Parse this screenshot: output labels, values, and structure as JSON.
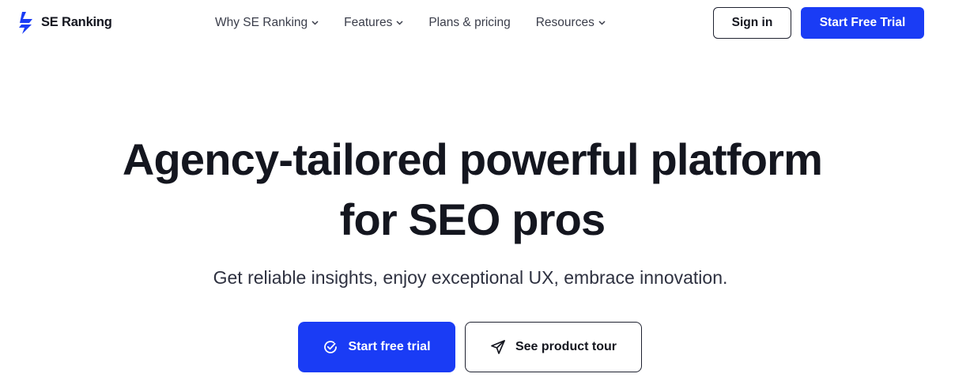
{
  "header": {
    "logo_text": "SE Ranking",
    "nav": [
      {
        "label": "Why SE Ranking",
        "has_dropdown": true
      },
      {
        "label": "Features",
        "has_dropdown": true
      },
      {
        "label": "Plans & pricing",
        "has_dropdown": false
      },
      {
        "label": "Resources",
        "has_dropdown": true
      }
    ],
    "sign_in_label": "Sign in",
    "start_trial_label": "Start Free Trial"
  },
  "hero": {
    "title_line1": "Agency-tailored powerful platform",
    "title_line2": "for SEO pros",
    "subtitle": "Get reliable insights, enjoy exceptional UX, embrace innovation.",
    "cta_primary_label": "Start free trial",
    "cta_primary_icon": "check-circle-icon",
    "cta_secondary_label": "See product tour",
    "cta_secondary_icon": "paper-plane-icon"
  },
  "colors": {
    "brand_blue": "#1a3cf5",
    "text_dark": "#14161f",
    "background": "#ffffff"
  }
}
